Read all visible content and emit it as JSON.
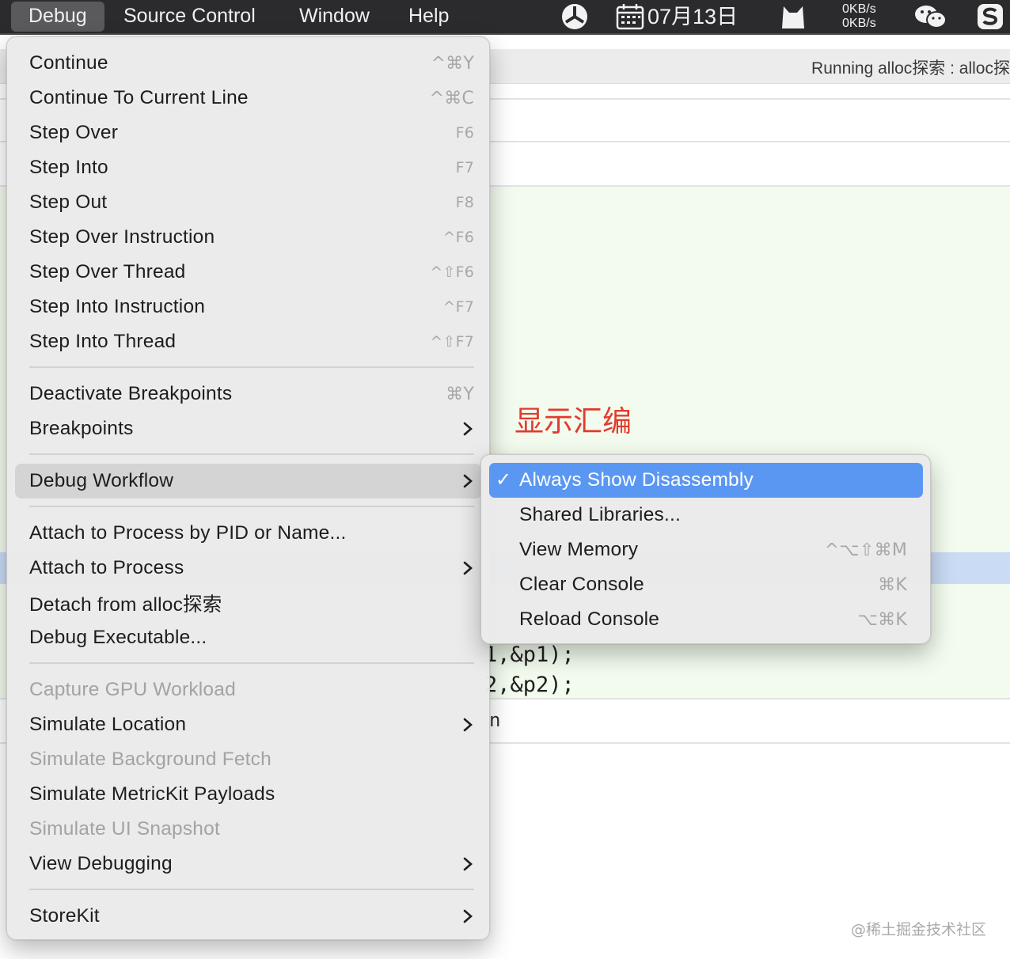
{
  "menubar": {
    "items": [
      "Debug",
      "Source Control",
      "Window",
      "Help"
    ],
    "date": "07月13日",
    "net_up": "0KB/s",
    "net_down": "0KB/s"
  },
  "window": {
    "running_status": "Running alloc探索 : alloc探"
  },
  "code": {
    "line1": "1,&p1);",
    "line2": "2,&p2);",
    "tail": "n"
  },
  "annotation": "显示汇编",
  "watermark": "@稀土掘金技术社区",
  "debug_menu": {
    "items": [
      {
        "label": "Continue",
        "shortcut": "^⌘Y"
      },
      {
        "label": "Continue To Current Line",
        "shortcut": "^⌘C"
      },
      {
        "label": "Step Over",
        "shortcut": "F6"
      },
      {
        "label": "Step Into",
        "shortcut": "F7"
      },
      {
        "label": "Step Out",
        "shortcut": "F8"
      },
      {
        "label": "Step Over Instruction",
        "shortcut": "^F6"
      },
      {
        "label": "Step Over Thread",
        "shortcut": "^⇧F6"
      },
      {
        "label": "Step Into Instruction",
        "shortcut": "^F7"
      },
      {
        "label": "Step Into Thread",
        "shortcut": "^⇧F7"
      },
      {
        "label": "Deactivate Breakpoints",
        "shortcut": "⌘Y"
      },
      {
        "label": "Breakpoints"
      },
      {
        "label": "Debug Workflow"
      },
      {
        "label": "Attach to Process by PID or Name..."
      },
      {
        "label": "Attach to Process"
      },
      {
        "label": "Detach from alloc探索"
      },
      {
        "label": "Debug Executable..."
      },
      {
        "label": "Capture GPU Workload"
      },
      {
        "label": "Simulate Location"
      },
      {
        "label": "Simulate Background Fetch"
      },
      {
        "label": "Simulate MetricKit Payloads"
      },
      {
        "label": "Simulate UI Snapshot"
      },
      {
        "label": "View Debugging"
      },
      {
        "label": "StoreKit"
      }
    ]
  },
  "workflow_submenu": {
    "items": [
      {
        "label": "Always Show Disassembly",
        "checked": "✓"
      },
      {
        "label": "Shared Libraries..."
      },
      {
        "label": "View Memory",
        "shortcut": "^⌥⇧⌘M"
      },
      {
        "label": "Clear Console",
        "shortcut": "⌘K"
      },
      {
        "label": "Reload Console",
        "shortcut": "⌥⌘K"
      }
    ]
  },
  "colors": {
    "menubar_bg": "#2b2b2d",
    "menu_bg": "#eaeaea",
    "selection_blue": "#5a97f2",
    "annotation_red": "#e23b2e",
    "code_green_bg": "#f2fbee"
  }
}
